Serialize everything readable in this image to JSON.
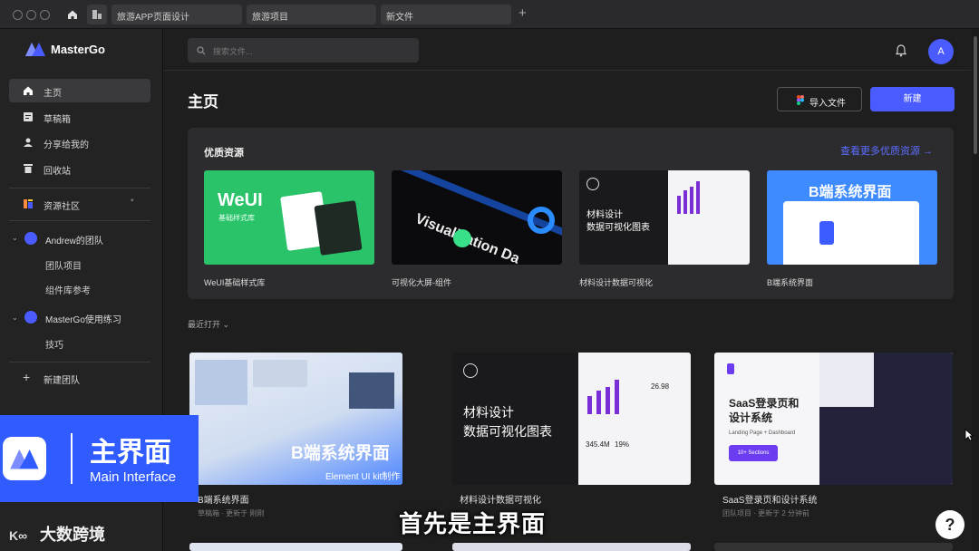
{
  "titlebar": {
    "tabs": [
      "旅游APP页面设计",
      "旅游项目",
      "新文件"
    ],
    "new_tab": "+"
  },
  "sidebar": {
    "brand": "MasterGo",
    "nav": [
      {
        "label": "主页",
        "icon": "home-icon",
        "active": true
      },
      {
        "label": "草稿箱",
        "icon": "draft-icon"
      },
      {
        "label": "分享给我的",
        "icon": "user-icon"
      },
      {
        "label": "回收站",
        "icon": "trash-icon"
      }
    ],
    "community": "资源社区",
    "teams": [
      {
        "name": "Andrew的团队",
        "children": [
          "团队项目",
          "组件库参考"
        ]
      },
      {
        "name": "MasterGo使用练习",
        "children": [
          "技巧"
        ]
      }
    ],
    "new_team": "新建团队"
  },
  "header": {
    "search_placeholder": "搜索文件...",
    "avatar_initial": "A"
  },
  "main": {
    "title": "主页",
    "import_label": "导入文件",
    "new_label": "新建",
    "featured": {
      "title": "优质资源",
      "more_link": "查看更多优质资源 →",
      "cards": [
        {
          "caption": "WeUI基础样式库",
          "thumb_title": "WeUI",
          "thumb_sub": "基础样式库"
        },
        {
          "caption": "可视化大屏-组件",
          "thumb_title": "Visualization Da"
        },
        {
          "caption": "材料设计数据可视化",
          "thumb_title": "材料设计",
          "thumb_sub": "数据可视化图表"
        },
        {
          "caption": "B端系统界面",
          "thumb_title": "B端系统界面"
        }
      ]
    },
    "recent_label": "最近打开",
    "recent": [
      {
        "caption": "B端系统界面",
        "sub": "草稿箱 · 更新于 刚刚",
        "thumb_title": "B端系统界面",
        "thumb_sub": "Element UI kit制作"
      },
      {
        "caption": "材料设计数据可视化",
        "sub": "",
        "thumb_title": "材料设计",
        "thumb_sub": "数据可视化图表",
        "stats": [
          "345.4M",
          "19%",
          "26.98"
        ]
      },
      {
        "caption": "SaaS登录页和设计系统",
        "sub": "团队项目 · 更新于 2 分钟前",
        "thumb_title": "SaaS登录页和",
        "thumb_title2": "设计系统",
        "thumb_sub": "Landing Page + Dashboard",
        "thumb_btn": "10+ Sections"
      }
    ]
  },
  "overlay": {
    "badge_title": "主界面",
    "badge_sub": "Main Interface",
    "subtitle": "首先是主界面",
    "watermark": "大数跨境",
    "help": "?"
  },
  "colors": {
    "accent": "#4a5cff",
    "bg": "#1e1e1f",
    "sidebar": "#232324",
    "panel": "#2c2c2e"
  }
}
